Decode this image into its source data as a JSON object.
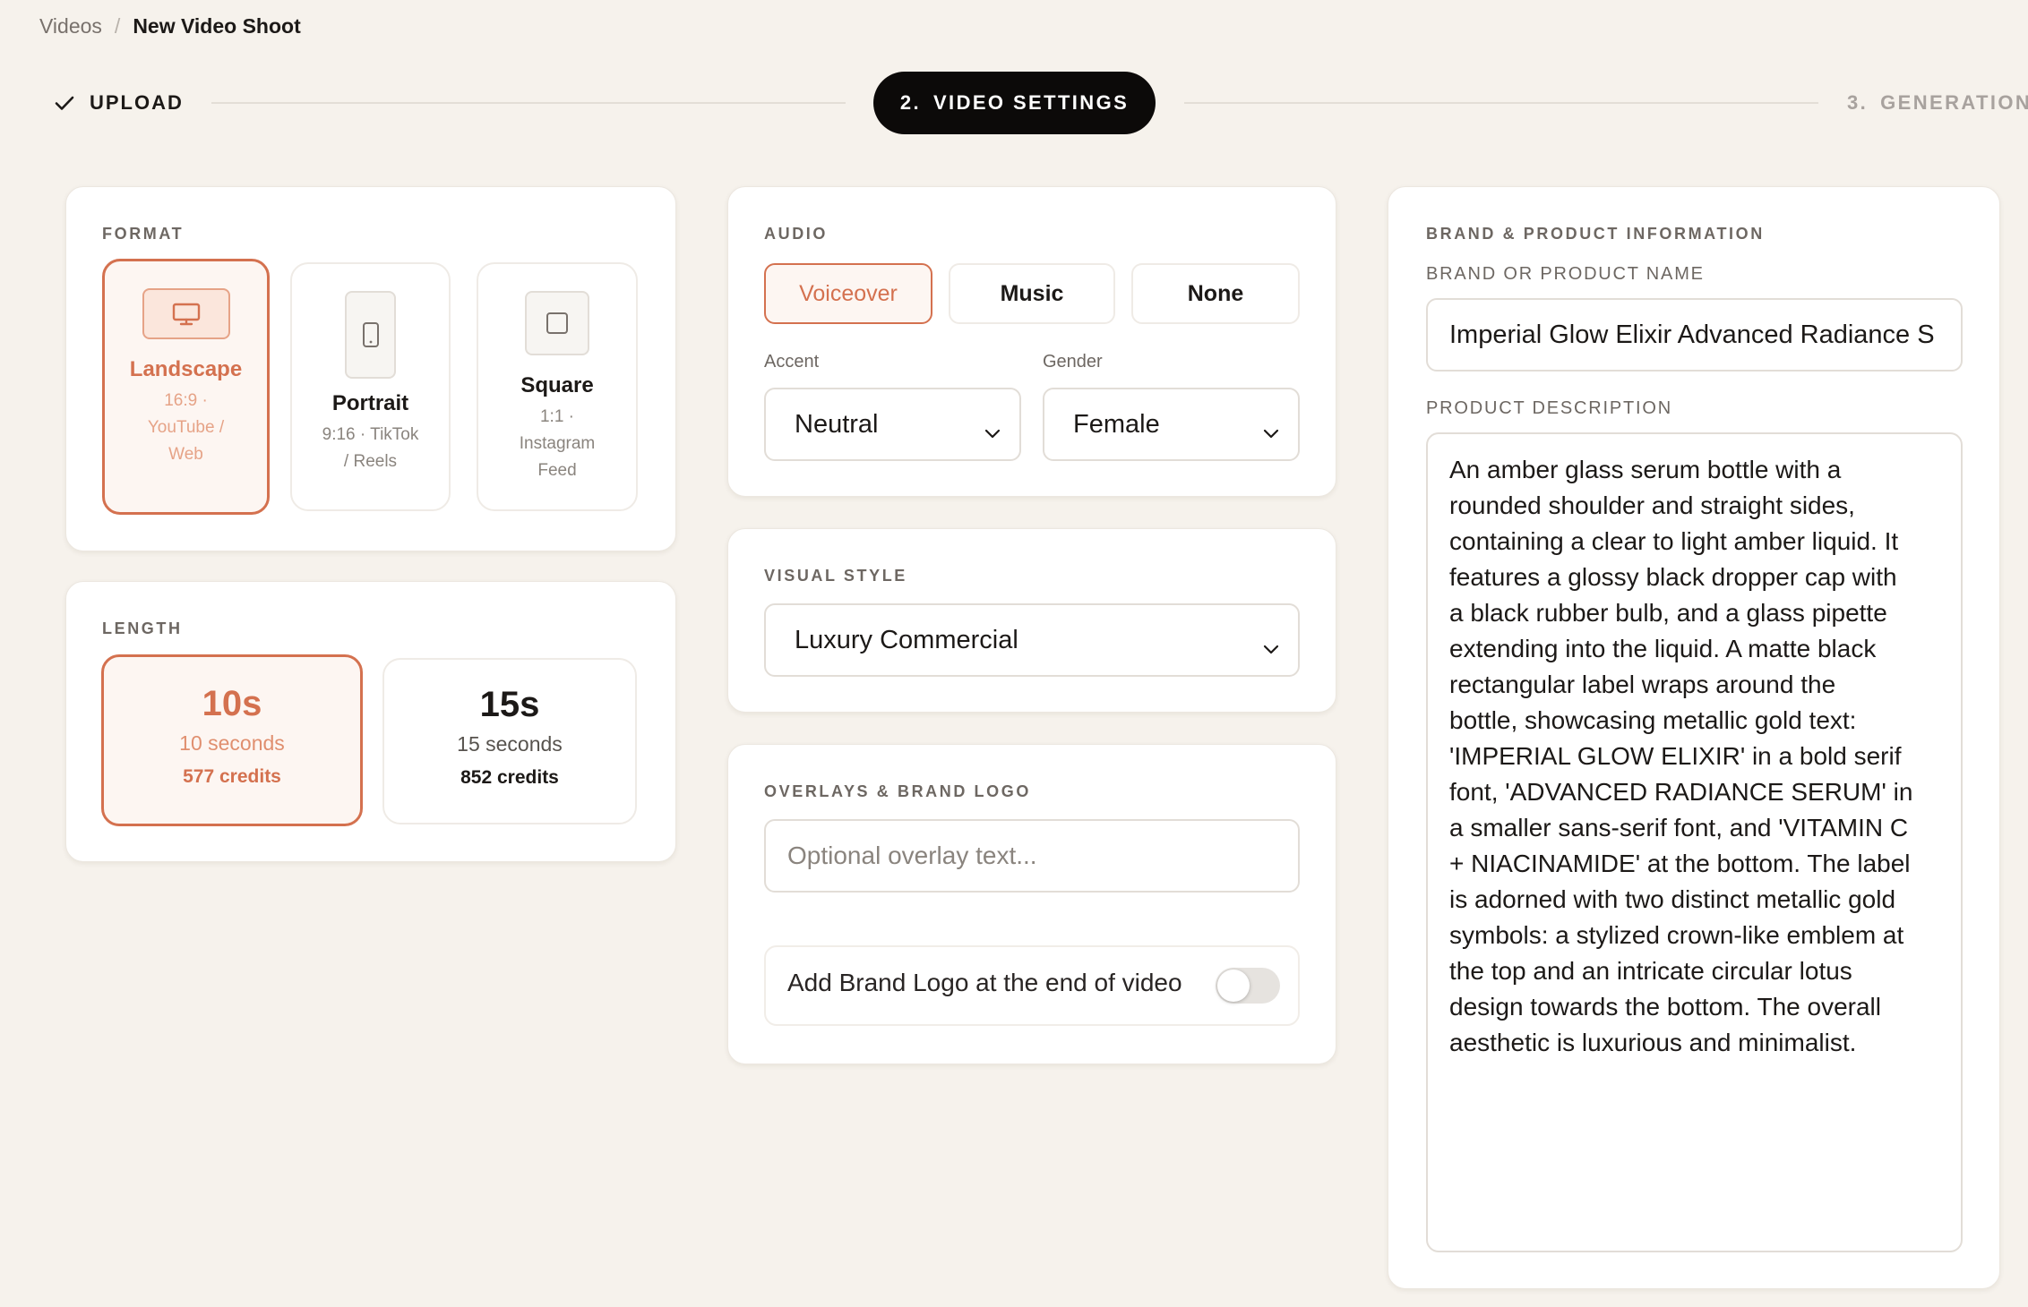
{
  "breadcrumb": {
    "parent": "Videos",
    "separator": "/",
    "current": "New Video Shoot"
  },
  "stepper": {
    "done": {
      "label": "UPLOAD"
    },
    "active": {
      "number": "2.",
      "label": "VIDEO SETTINGS"
    },
    "next": {
      "number": "3.",
      "label": "GENERATION"
    }
  },
  "format": {
    "label": "FORMAT",
    "options": [
      {
        "title": "Landscape",
        "sub": [
          "16:9 ·",
          "YouTube /",
          "Web"
        ],
        "icon": "monitor-icon",
        "selected": true
      },
      {
        "title": "Portrait",
        "sub": [
          "9:16 · TikTok",
          "/ Reels"
        ],
        "icon": "phone-icon",
        "selected": false
      },
      {
        "title": "Square",
        "sub": [
          "1:1 ·",
          "Instagram",
          "Feed"
        ],
        "icon": "square-icon",
        "selected": false
      }
    ]
  },
  "length": {
    "label": "LENGTH",
    "options": [
      {
        "big": "10s",
        "mid": "10 seconds",
        "credits": "577 credits",
        "selected": true
      },
      {
        "big": "15s",
        "mid": "15 seconds",
        "credits": "852 credits",
        "selected": false
      }
    ]
  },
  "audio": {
    "label": "AUDIO",
    "options": [
      "Voiceover",
      "Music",
      "None"
    ],
    "selected": "Voiceover",
    "accent": {
      "label": "Accent",
      "value": "Neutral"
    },
    "gender": {
      "label": "Gender",
      "value": "Female"
    }
  },
  "visual_style": {
    "label": "VISUAL STYLE",
    "value": "Luxury Commercial"
  },
  "overlays": {
    "label": "OVERLAYS & BRAND LOGO",
    "placeholder": "Optional overlay text...",
    "toggle_label": "Add Brand Logo at the end of video",
    "toggle_on": false
  },
  "brand": {
    "label": "BRAND & PRODUCT INFORMATION",
    "name_label": "BRAND OR PRODUCT NAME",
    "name_value": "Imperial Glow Elixir Advanced Radiance S",
    "desc_label": "PRODUCT DESCRIPTION",
    "desc_lines": [
      "An amber glass serum bottle with a",
      "rounded shoulder and straight sides,",
      "containing a clear to light amber liquid. It",
      "features a glossy black dropper cap with",
      "a black rubber bulb, and a glass pipette",
      "extending into the liquid. A matte black",
      "rectangular label wraps around the",
      "bottle, showcasing metallic gold text:",
      "'IMPERIAL GLOW ELIXIR' in a bold serif",
      "font, 'ADVANCED RADIANCE SERUM' in",
      "a smaller sans-serif font, and 'VITAMIN C",
      "+ NIACINAMIDE' at the bottom. The label",
      "is adorned with two distinct metallic gold",
      "symbols: a stylized crown-like emblem at",
      "the top and an intricate circular lotus",
      "design towards the bottom. The overall",
      "aesthetic is luxurious and minimalist."
    ]
  },
  "colors": {
    "accent": "#d4714f",
    "background": "#f6f2ec",
    "active_step": "#0c0a09"
  }
}
